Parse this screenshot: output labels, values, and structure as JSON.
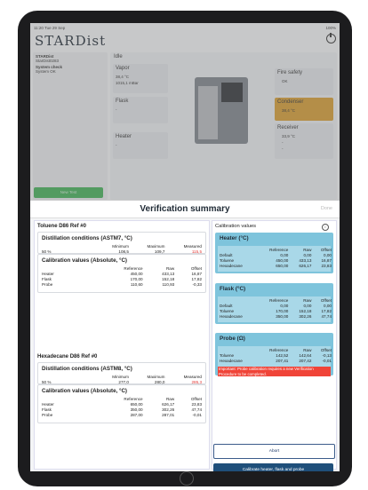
{
  "status": {
    "time": "11:20  Tue 29 Sep",
    "battery": "100%"
  },
  "app": {
    "logo": "STARDist"
  },
  "device": {
    "name": "STARDist",
    "serial": "StarDist0283",
    "system_check_label": "System check",
    "system_check_value": "System OK"
  },
  "state": {
    "label": "Idle"
  },
  "vapor": {
    "label": "Vapor",
    "temp": "38,4 °C",
    "pressure": "1015,1 mBar"
  },
  "flask": {
    "label": "Flask",
    "value": "-"
  },
  "heater": {
    "label": "Heater",
    "value": "-"
  },
  "fire": {
    "label": "Fire safety",
    "value": "OK"
  },
  "condenser": {
    "label": "Condenser",
    "value": "38,4 °C"
  },
  "receiver": {
    "label": "Receiver",
    "temp": "33,9 °C",
    "v1": "-",
    "v2": "-"
  },
  "new_test": "New Test",
  "modal": {
    "title": "Verification summary",
    "done": "Done"
  },
  "toluene": {
    "title": "Toluene D86 Ref #0",
    "dist_title": "Distillation conditions (ASTM7, °C)",
    "dist_headers": [
      "Minimum",
      "Maximum",
      "Measured"
    ],
    "dist_rows": [
      [
        "50 %",
        "108,5",
        "109,7",
        "115,5"
      ]
    ],
    "cal_title": "Calibration values (Absolute, °C)",
    "cal_headers": [
      "Reference",
      "Raw",
      "Offset"
    ],
    "cal_rows": [
      [
        "Heater",
        "450,00",
        "433,13",
        "16,87"
      ],
      [
        "Flask",
        "170,00",
        "152,18",
        "17,82"
      ],
      [
        "Probe",
        "110,60",
        "110,93",
        "-0,33"
      ]
    ]
  },
  "hexadecane": {
    "title": "Hexadecane D86 Ref #0",
    "dist_title": "Distillation conditions (ASTM8, °C)",
    "dist_headers": [
      "Minimum",
      "Maximum",
      "Measured"
    ],
    "dist_rows": [
      [
        "50 %",
        "277,0",
        "280,0",
        "285,3"
      ]
    ],
    "cal_title": "Calibration values (Absolute, °C)",
    "cal_headers": [
      "Reference",
      "Raw",
      "Offset"
    ],
    "cal_rows": [
      [
        "Heater",
        "650,00",
        "626,17",
        "23,83"
      ],
      [
        "Flask",
        "350,00",
        "302,26",
        "47,74"
      ],
      [
        "Probe",
        "287,00",
        "287,01",
        "-0,01"
      ]
    ]
  },
  "calib_panel": {
    "title": "Calibration values",
    "headers": [
      "Reference",
      "Raw",
      "Offset"
    ],
    "heater": {
      "title": "Heater (°C)",
      "rows": [
        [
          "Default",
          "0,00",
          "0,00",
          "0,00"
        ],
        [
          "Toluene",
          "450,00",
          "433,13",
          "16,87"
        ],
        [
          "Hexadecane",
          "650,00",
          "626,17",
          "23,83"
        ]
      ]
    },
    "flask": {
      "title": "Flask (°C)",
      "rows": [
        [
          "Default",
          "0,00",
          "0,00",
          "0,00"
        ],
        [
          "Toluene",
          "170,00",
          "152,18",
          "17,82"
        ],
        [
          "Hexadecane",
          "350,00",
          "302,26",
          "47,74"
        ]
      ]
    },
    "probe": {
      "title": "Probe (Ω)",
      "rows": [
        [
          "Toluene",
          "142,52",
          "142,64",
          "-0,13"
        ],
        [
          "Hexadecane",
          "207,41",
          "207,42",
          "-0,01"
        ]
      ]
    },
    "warning": "Important: Probe calibration requires a new Verification Procedure to be completed."
  },
  "buttons": {
    "abort": "Abort",
    "calibrate": "Calibrate heater, flask and probe"
  }
}
